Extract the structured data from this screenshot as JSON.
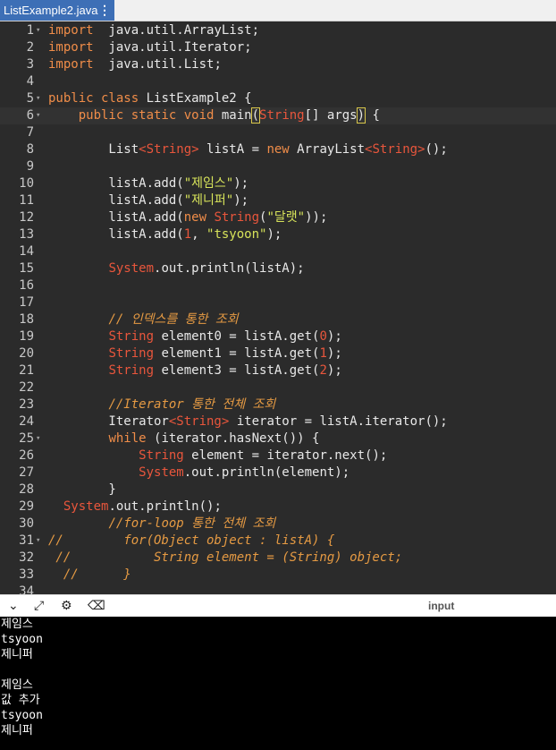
{
  "tab": {
    "filename": "ListExample2.java",
    "menu_icon": "vertical-ellipsis-icon"
  },
  "editor": {
    "active_line": 6,
    "lines": [
      {
        "n": "1",
        "fold": true,
        "segs": [
          [
            "kw",
            "import"
          ],
          [
            "",
            "  java.util.ArrayList;"
          ]
        ]
      },
      {
        "n": "2",
        "segs": [
          [
            "kw",
            "import"
          ],
          [
            "",
            "  java.util.Iterator;"
          ]
        ]
      },
      {
        "n": "3",
        "segs": [
          [
            "kw",
            "import"
          ],
          [
            "",
            "  java.util.List;"
          ]
        ]
      },
      {
        "n": "4",
        "segs": []
      },
      {
        "n": "5",
        "fold": true,
        "segs": [
          [
            "kw",
            "public class"
          ],
          [
            "",
            " ListExample2 {"
          ]
        ]
      },
      {
        "n": "6",
        "fold": true,
        "segs": [
          [
            "",
            "    "
          ],
          [
            "kw",
            "public static void"
          ],
          [
            "",
            " main"
          ],
          [
            "paren",
            "("
          ],
          [
            "ty",
            "String"
          ],
          [
            "",
            "[] args"
          ],
          [
            "paren",
            ")"
          ],
          [
            "",
            " {"
          ]
        ]
      },
      {
        "n": "7",
        "segs": []
      },
      {
        "n": "8",
        "segs": [
          [
            "",
            "        List"
          ],
          [
            "ty",
            "<String>"
          ],
          [
            "",
            " listA = "
          ],
          [
            "kw",
            "new"
          ],
          [
            "",
            " ArrayList"
          ],
          [
            "ty",
            "<String>"
          ],
          [
            "",
            "();"
          ]
        ]
      },
      {
        "n": "9",
        "segs": []
      },
      {
        "n": "10",
        "segs": [
          [
            "",
            "        listA.add("
          ],
          [
            "str",
            "\"제임스\""
          ],
          [
            "",
            ");"
          ]
        ]
      },
      {
        "n": "11",
        "segs": [
          [
            "",
            "        listA.add("
          ],
          [
            "str",
            "\"제니퍼\""
          ],
          [
            "",
            ");"
          ]
        ]
      },
      {
        "n": "12",
        "segs": [
          [
            "",
            "        listA.add("
          ],
          [
            "kw",
            "new"
          ],
          [
            "",
            " "
          ],
          [
            "ty",
            "String"
          ],
          [
            "",
            "("
          ],
          [
            "str",
            "\"달랫\""
          ],
          [
            "",
            "));"
          ]
        ]
      },
      {
        "n": "13",
        "segs": [
          [
            "",
            "        listA.add("
          ],
          [
            "num",
            "1"
          ],
          [
            "",
            ", "
          ],
          [
            "str",
            "\"tsyoon\""
          ],
          [
            "",
            ");"
          ]
        ]
      },
      {
        "n": "14",
        "segs": []
      },
      {
        "n": "15",
        "segs": [
          [
            "",
            "        "
          ],
          [
            "ty",
            "System"
          ],
          [
            "",
            ".out.println(listA);"
          ]
        ]
      },
      {
        "n": "16",
        "segs": []
      },
      {
        "n": "17",
        "segs": []
      },
      {
        "n": "18",
        "segs": [
          [
            "",
            "        "
          ],
          [
            "cm",
            "// 인덱스를 통한 조회"
          ]
        ]
      },
      {
        "n": "19",
        "segs": [
          [
            "",
            "        "
          ],
          [
            "ty",
            "String"
          ],
          [
            "",
            " element0 = listA.get("
          ],
          [
            "num",
            "0"
          ],
          [
            "",
            ");"
          ]
        ]
      },
      {
        "n": "20",
        "segs": [
          [
            "",
            "        "
          ],
          [
            "ty",
            "String"
          ],
          [
            "",
            " element1 = listA.get("
          ],
          [
            "num",
            "1"
          ],
          [
            "",
            ");"
          ]
        ]
      },
      {
        "n": "21",
        "segs": [
          [
            "",
            "        "
          ],
          [
            "ty",
            "String"
          ],
          [
            "",
            " element3 = listA.get("
          ],
          [
            "num",
            "2"
          ],
          [
            "",
            ");"
          ]
        ]
      },
      {
        "n": "22",
        "segs": []
      },
      {
        "n": "23",
        "segs": [
          [
            "",
            "        "
          ],
          [
            "cm",
            "//Iterator 통한 전체 조회"
          ]
        ]
      },
      {
        "n": "24",
        "segs": [
          [
            "",
            "        Iterator"
          ],
          [
            "ty",
            "<String>"
          ],
          [
            "",
            " iterator = listA.iterator();"
          ]
        ]
      },
      {
        "n": "25",
        "fold": true,
        "segs": [
          [
            "",
            "        "
          ],
          [
            "kw",
            "while"
          ],
          [
            "",
            " (iterator.hasNext()) {"
          ]
        ]
      },
      {
        "n": "26",
        "segs": [
          [
            "",
            "            "
          ],
          [
            "ty",
            "String"
          ],
          [
            "",
            " element = iterator.next();"
          ]
        ]
      },
      {
        "n": "27",
        "segs": [
          [
            "",
            "            "
          ],
          [
            "ty",
            "System"
          ],
          [
            "",
            ".out.println(element);"
          ]
        ]
      },
      {
        "n": "28",
        "segs": [
          [
            "",
            "        }"
          ]
        ]
      },
      {
        "n": "29",
        "segs": [
          [
            "",
            "  "
          ],
          [
            "ty",
            "System"
          ],
          [
            "",
            ".out.println();"
          ]
        ]
      },
      {
        "n": "30",
        "segs": [
          [
            "",
            "        "
          ],
          [
            "cm",
            "//for-loop 통한 전체 조회"
          ]
        ]
      },
      {
        "n": "31",
        "fold": true,
        "segs": [
          [
            "cm",
            "//        for(Object object : listA) {"
          ]
        ]
      },
      {
        "n": "32",
        "segs": [
          [
            "cm",
            " //           String element = (String) object;"
          ]
        ]
      },
      {
        "n": "33",
        "segs": [
          [
            "cm",
            "  //      }"
          ]
        ]
      },
      {
        "n": "34",
        "segs": []
      }
    ]
  },
  "panel": {
    "collapse_icon": "chevron-down-icon",
    "expand_icon": "expand-arrows-icon",
    "settings_icon": "gear-icon",
    "clear_icon": "clear-console-icon",
    "input_label": "input"
  },
  "console": {
    "lines": [
      "제임스",
      "tsyoon",
      "제니퍼",
      "",
      "제임스",
      "값 추가",
      "tsyoon",
      "제니퍼"
    ]
  }
}
